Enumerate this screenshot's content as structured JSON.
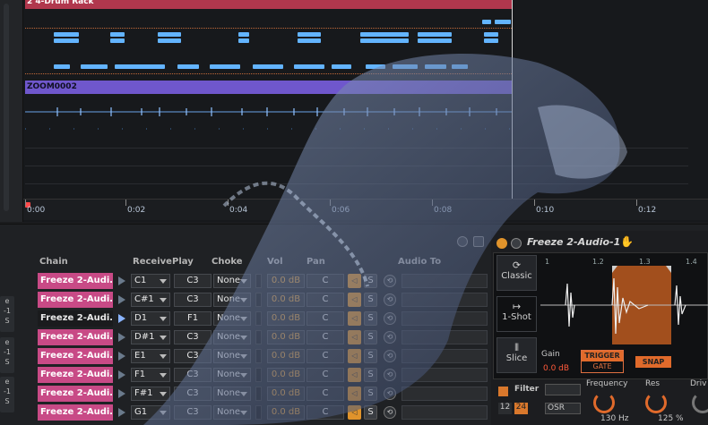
{
  "arrangement": {
    "tracks": [
      {
        "clip_label": "2 4-Drum Rack"
      },
      {
        "clip_label": "ZOOM0002"
      }
    ],
    "ruler": [
      "0:00",
      "0:02",
      "0:04",
      "0:06",
      "0:08",
      "0:10",
      "0:12"
    ]
  },
  "rack": {
    "headers": {
      "chain": "Chain",
      "receive": "Receive",
      "play": "Play",
      "choke": "Choke",
      "vol": "Vol",
      "pan": "Pan",
      "audio_to": "Audio To"
    },
    "rows": [
      {
        "name": "Freeze 2-Audi…",
        "receive": "C1",
        "play": "C3",
        "choke": "None",
        "vol": "0.0 dB",
        "pan": "C",
        "mute": "◁",
        "solo": "S"
      },
      {
        "name": "Freeze 2-Audi…",
        "receive": "C#1",
        "play": "C3",
        "choke": "None",
        "vol": "0.0 dB",
        "pan": "C",
        "mute": "◁",
        "solo": "S"
      },
      {
        "name": "Freeze 2-Audi…",
        "receive": "D1",
        "play": "F1",
        "choke": "None",
        "vol": "0.0 dB",
        "pan": "C",
        "mute": "◁",
        "solo": "S"
      },
      {
        "name": "Freeze 2-Audi…",
        "receive": "D#1",
        "play": "C3",
        "choke": "None",
        "vol": "0.0 dB",
        "pan": "C",
        "mute": "◁",
        "solo": "S"
      },
      {
        "name": "Freeze 2-Audi…",
        "receive": "E1",
        "play": "C3",
        "choke": "None",
        "vol": "0.0 dB",
        "pan": "C",
        "mute": "◁",
        "solo": "S"
      },
      {
        "name": "Freeze 2-Audi…",
        "receive": "F1",
        "play": "C3",
        "choke": "None",
        "vol": "0.0 dB",
        "pan": "C",
        "mute": "◁",
        "solo": "S"
      },
      {
        "name": "Freeze 2-Audi…",
        "receive": "F#1",
        "play": "C3",
        "choke": "None",
        "vol": "0.0 dB",
        "pan": "C",
        "mute": "◁",
        "solo": "S"
      },
      {
        "name": "Freeze 2-Audi…",
        "receive": "G1",
        "play": "C3",
        "choke": "None",
        "vol": "0.0 dB",
        "pan": "C",
        "mute": "◁",
        "solo": "S"
      }
    ],
    "side_labels": [
      "e",
      "-1",
      "S",
      "e",
      "-1",
      "S",
      "e",
      "-1",
      "S"
    ]
  },
  "simpler": {
    "title": "Freeze 2-Audio-1",
    "modes": [
      "Classic",
      "1-Shot",
      "Slice"
    ],
    "bar_numbers": [
      "1",
      "1.2",
      "1.3",
      "1.4"
    ],
    "gain_label": "Gain",
    "gain_value": "0.0 dB",
    "trigger": "TRIGGER",
    "gate": "GATE",
    "snap": "SNAP",
    "filter_label": "Filter",
    "frequency_label": "Frequency",
    "res_label": "Res",
    "drive_label": "Driv",
    "frequency_value": "130 Hz",
    "res_value": "125 %",
    "slope_12": "12",
    "slope_24": "24",
    "osr": "OSR"
  },
  "colors": {
    "drum_clip": "#b0374d",
    "zoom_clip": "#6f57cc",
    "chain_row": "#c84a86",
    "accent_orange": "#e06a2b",
    "midi_notes": "#63b4ff"
  }
}
